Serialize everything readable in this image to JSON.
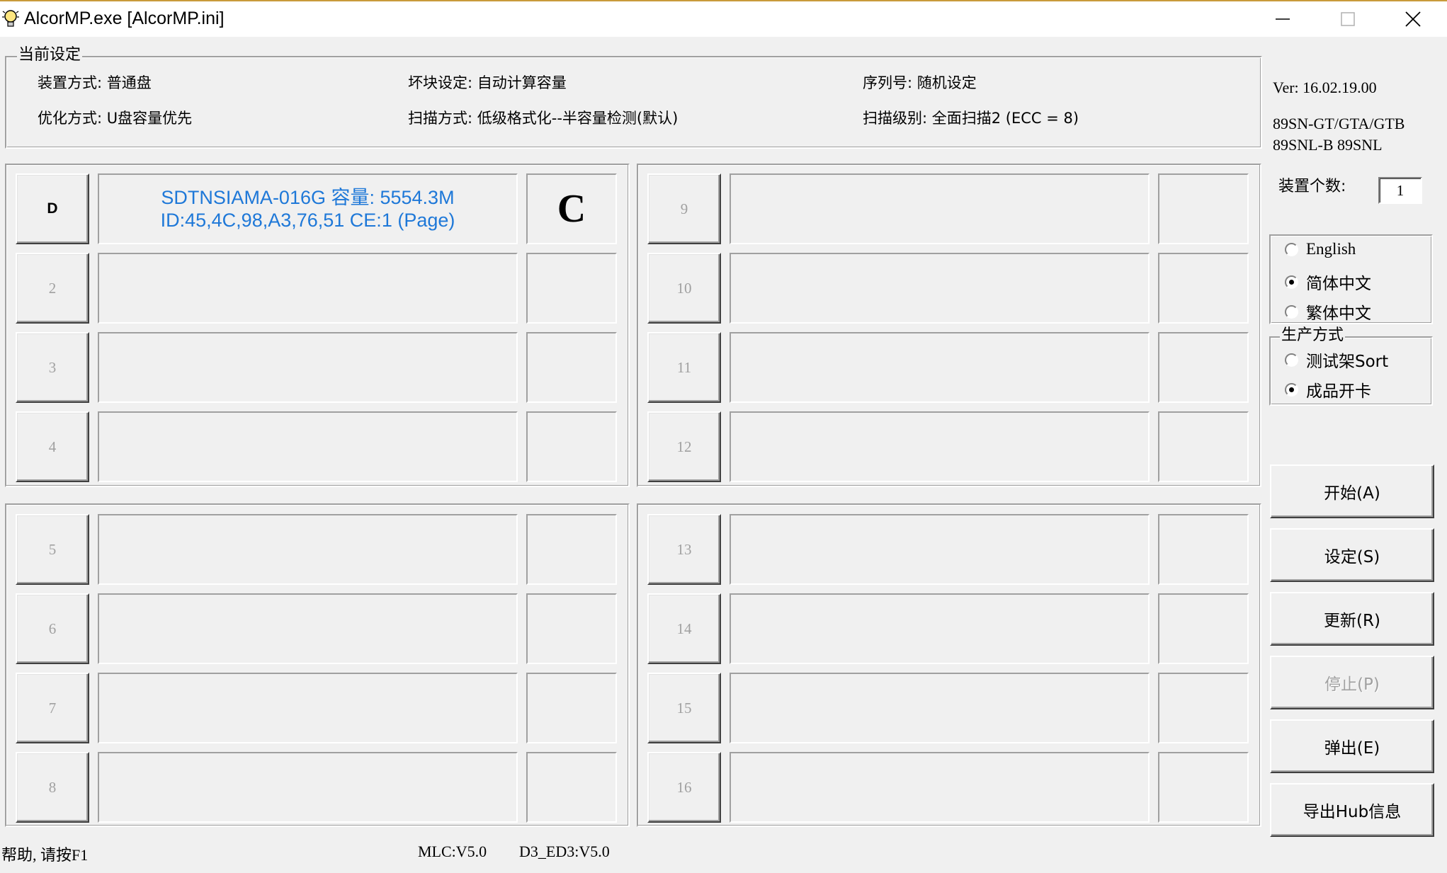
{
  "window": {
    "title": "AlcorMP.exe [AlcorMP.ini]"
  },
  "settings": {
    "legend": "当前设定",
    "device_mode": "装置方式: 普通盘",
    "optimize_mode": "优化方式: U盘容量优先",
    "bad_block": "坏块设定: 自动计算容量",
    "scan_mode": "扫描方式: 低级格式化--半容量检测(默认)",
    "serial": "序列号: 随机设定",
    "scan_level": "扫描级别: 全面扫描2 (ECC = 8)"
  },
  "version": {
    "ver": "Ver: 16.02.19.00",
    "models_1": "89SN-GT/GTA/GTB",
    "models_2": "89SNL-B 89SNL"
  },
  "device_count": {
    "label": "装置个数:",
    "value": "1"
  },
  "language": {
    "options": [
      "English",
      "简体中文",
      "繁体中文"
    ],
    "selected": "简体中文"
  },
  "production": {
    "legend": "生产方式",
    "options": [
      "测试架Sort",
      "成品开卡"
    ],
    "selected": "成品开卡"
  },
  "slots": [
    {
      "label": "D",
      "line1": "SDTNSIAMA-016G 容量: 5554.3M",
      "line2": "ID:45,4C,98,A3,76,51 CE:1 (Page)",
      "drive": "C"
    },
    {
      "label": "2",
      "line1": "",
      "line2": "",
      "drive": ""
    },
    {
      "label": "3",
      "line1": "",
      "line2": "",
      "drive": ""
    },
    {
      "label": "4",
      "line1": "",
      "line2": "",
      "drive": ""
    },
    {
      "label": "5",
      "line1": "",
      "line2": "",
      "drive": ""
    },
    {
      "label": "6",
      "line1": "",
      "line2": "",
      "drive": ""
    },
    {
      "label": "7",
      "line1": "",
      "line2": "",
      "drive": ""
    },
    {
      "label": "8",
      "line1": "",
      "line2": "",
      "drive": ""
    },
    {
      "label": "9",
      "line1": "",
      "line2": "",
      "drive": ""
    },
    {
      "label": "10",
      "line1": "",
      "line2": "",
      "drive": ""
    },
    {
      "label": "11",
      "line1": "",
      "line2": "",
      "drive": ""
    },
    {
      "label": "12",
      "line1": "",
      "line2": "",
      "drive": ""
    },
    {
      "label": "13",
      "line1": "",
      "line2": "",
      "drive": ""
    },
    {
      "label": "14",
      "line1": "",
      "line2": "",
      "drive": ""
    },
    {
      "label": "15",
      "line1": "",
      "line2": "",
      "drive": ""
    },
    {
      "label": "16",
      "line1": "",
      "line2": "",
      "drive": ""
    }
  ],
  "buttons": {
    "start": "开始(A)",
    "settings": "设定(S)",
    "refresh": "更新(R)",
    "stop": "停止(P)",
    "eject": "弹出(E)",
    "export_hub": "导出Hub信息"
  },
  "status": {
    "help": "帮助, 请按F1",
    "mlc": "MLC:V5.0",
    "d3": "D3_ED3:V5.0"
  },
  "colors": {
    "info_text": "#1e78d8",
    "title_accent": "#c99a3a"
  }
}
